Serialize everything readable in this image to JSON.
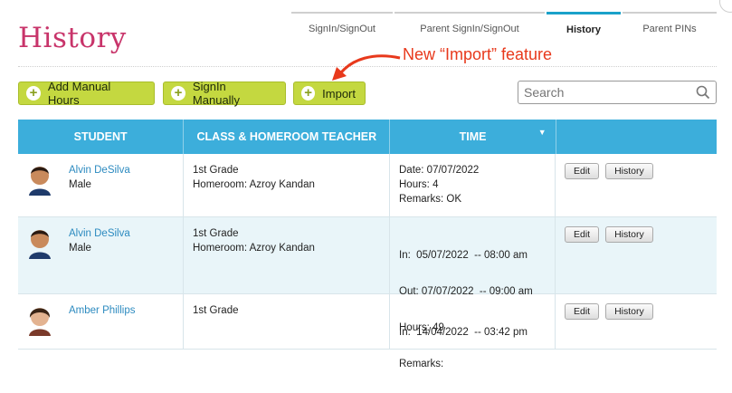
{
  "page": {
    "title": "History"
  },
  "tabs": [
    {
      "label": "SignIn/SignOut",
      "active": false
    },
    {
      "label": "Parent SignIn/SignOut",
      "active": false
    },
    {
      "label": "History",
      "active": true
    },
    {
      "label": "Parent PINs",
      "active": false
    }
  ],
  "annotation": {
    "text": "New “Import” feature",
    "color": "#e8391c"
  },
  "toolbar": {
    "add_manual_hours": "Add Manual Hours",
    "signin_manually": "SignIn Manually",
    "import": "Import"
  },
  "search": {
    "placeholder": "Search",
    "value": ""
  },
  "table": {
    "headers": {
      "student": "STUDENT",
      "class": "CLASS & HOMEROOM TEACHER",
      "time": "TIME",
      "actions": ""
    },
    "rows": [
      {
        "name": "Alvin DeSilva",
        "gender": "Male",
        "grade": "1st Grade",
        "homeroom": "Homeroom: Azroy Kandan",
        "time": [
          "Date: 07/07/2022",
          "Hours: 4",
          "Remarks: OK"
        ],
        "edit": "Edit",
        "history": "History"
      },
      {
        "name": "Alvin DeSilva",
        "gender": "Male",
        "grade": "1st Grade",
        "homeroom": "Homeroom: Azroy Kandan",
        "time": [
          "In:  05/07/2022  -- 08:00 am",
          "Out: 07/07/2022  -- 09:00 am",
          "Hours: 49",
          "Remarks:"
        ],
        "edit": "Edit",
        "history": "History"
      },
      {
        "name": "Amber Phillips",
        "gender": "",
        "grade": "1st Grade",
        "homeroom": "",
        "time": [
          "In:  14/04/2022  -- 03:42 pm"
        ],
        "edit": "Edit",
        "history": "History"
      }
    ]
  },
  "colors": {
    "accent": "#3caedb",
    "title": "#c8346a",
    "button": "#c4d840",
    "link": "#2d8bc0"
  }
}
